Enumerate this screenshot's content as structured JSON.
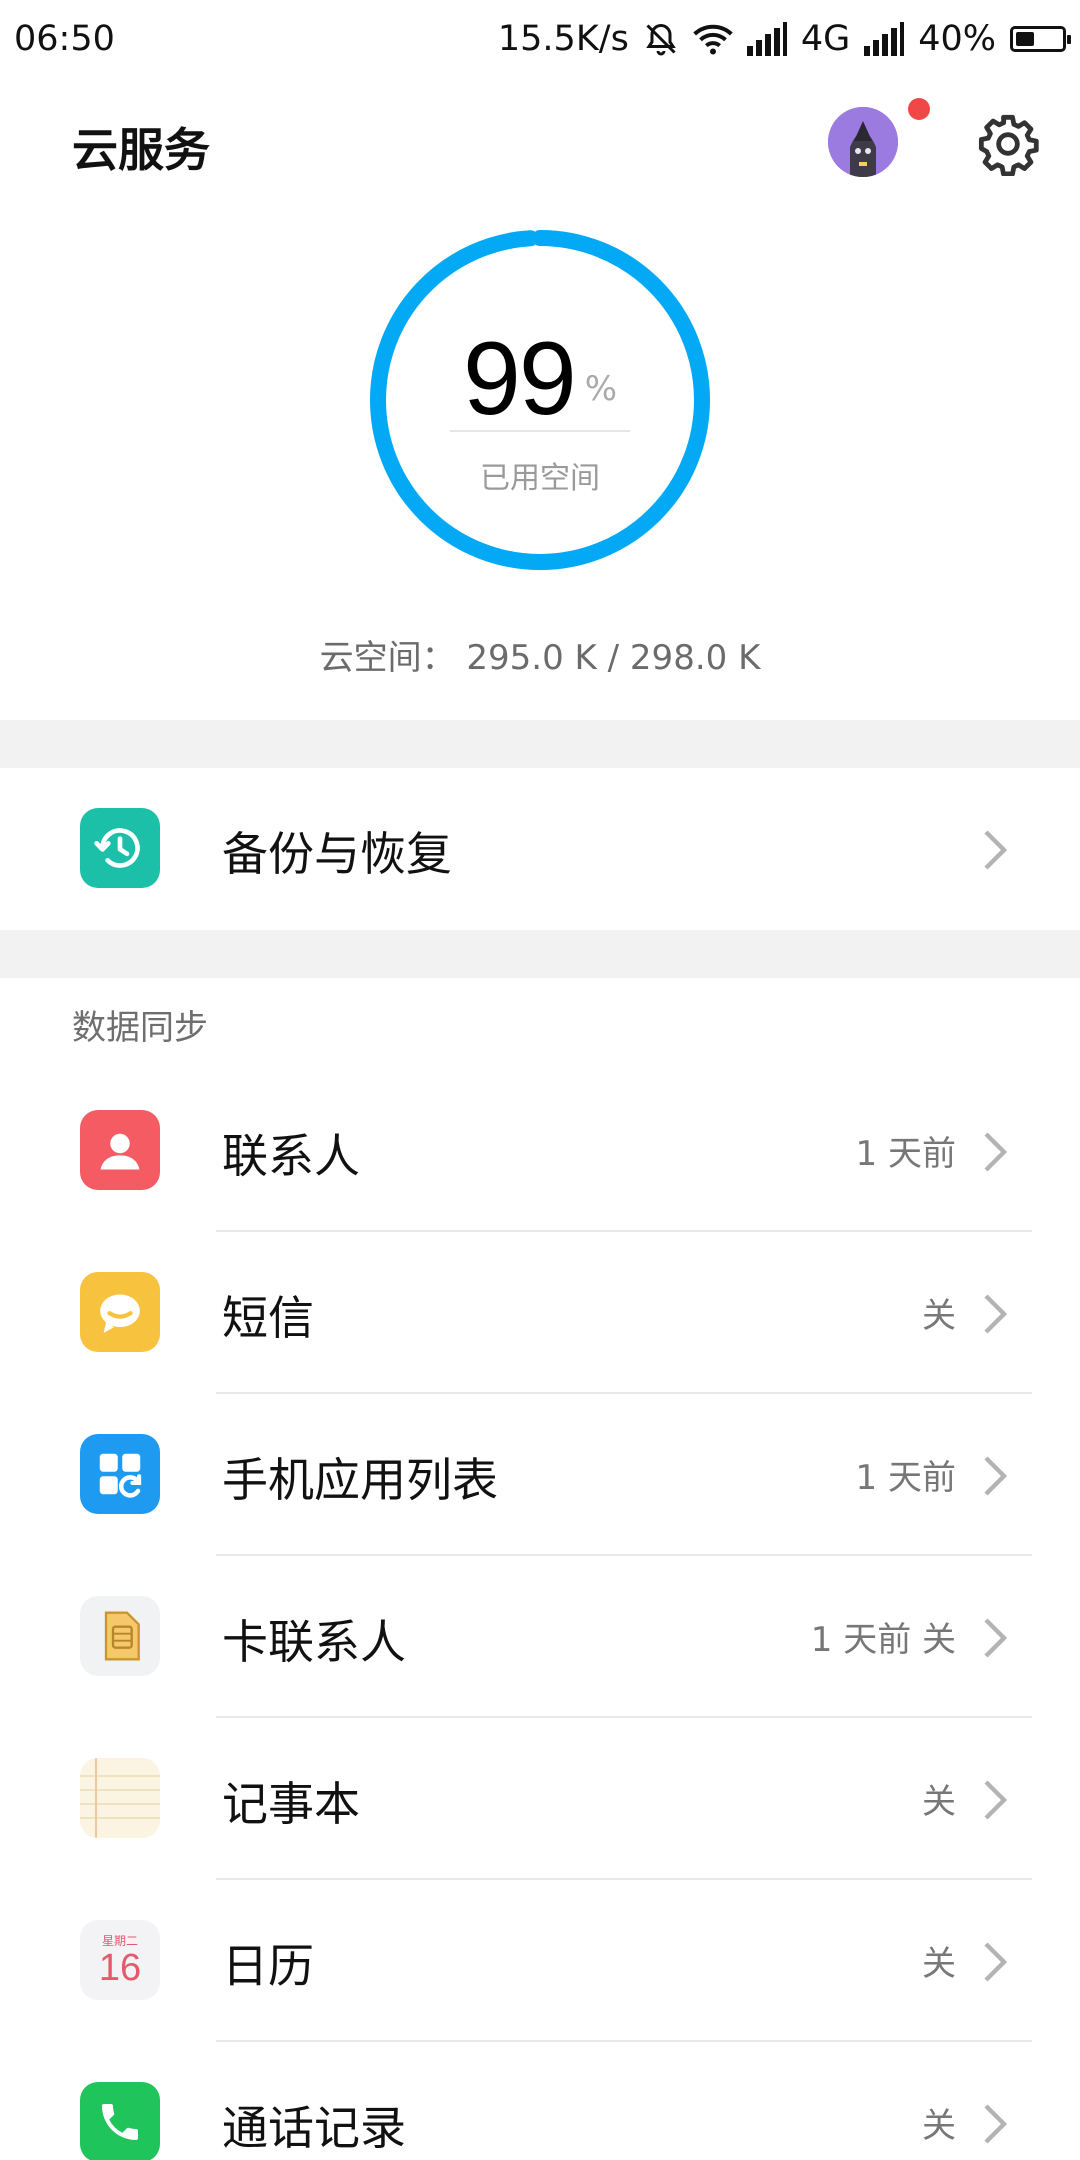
{
  "status_bar": {
    "time": "06:50",
    "net_speed": "15.5K/s",
    "network": "4G",
    "battery": "40%",
    "battery_level": 0.4,
    "icons": [
      "bell-off-icon",
      "wifi-icon",
      "signal-icon",
      "signal-icon",
      "battery-icon"
    ]
  },
  "header": {
    "title": "云服务",
    "icons": [
      "avatar",
      "settings-icon"
    ],
    "notification_dot_color": "#f04747"
  },
  "storage": {
    "percent": "99",
    "percent_unit": "%",
    "percent_value": 99,
    "label": "已用空间",
    "summary": "云空间：  295.0 K / 298.0 K",
    "ring_color": "#03a9f4"
  },
  "backup": {
    "label": "备份与恢复",
    "icon": "backup-clock-icon",
    "icon_color": "#1cc0a8"
  },
  "sync": {
    "section_title": "数据同步",
    "items": [
      {
        "label": "联系人",
        "meta": "1 天前",
        "icon": "contacts-icon",
        "icon_color": "#f45b63"
      },
      {
        "label": "短信",
        "meta": "关",
        "icon": "sms-icon",
        "icon_color": "#f7c23e"
      },
      {
        "label": "手机应用列表",
        "meta": "1 天前",
        "icon": "app-list-icon",
        "icon_color": "#1e9bf0"
      },
      {
        "label": "卡联系人",
        "meta": "1 天前  关",
        "icon": "sim-card-icon",
        "icon_color": "#f3f4f6"
      },
      {
        "label": "记事本",
        "meta": "关",
        "icon": "notepad-icon",
        "icon_color": "#fbf4e2"
      },
      {
        "label": "日历",
        "meta": "关",
        "icon": "calendar-icon",
        "icon_color": "#f3f3f5",
        "icon_text": "星期二",
        "icon_day": "16"
      },
      {
        "label": "通话记录",
        "meta": "关",
        "icon": "phone-icon",
        "icon_color": "#1fc45a"
      }
    ]
  }
}
